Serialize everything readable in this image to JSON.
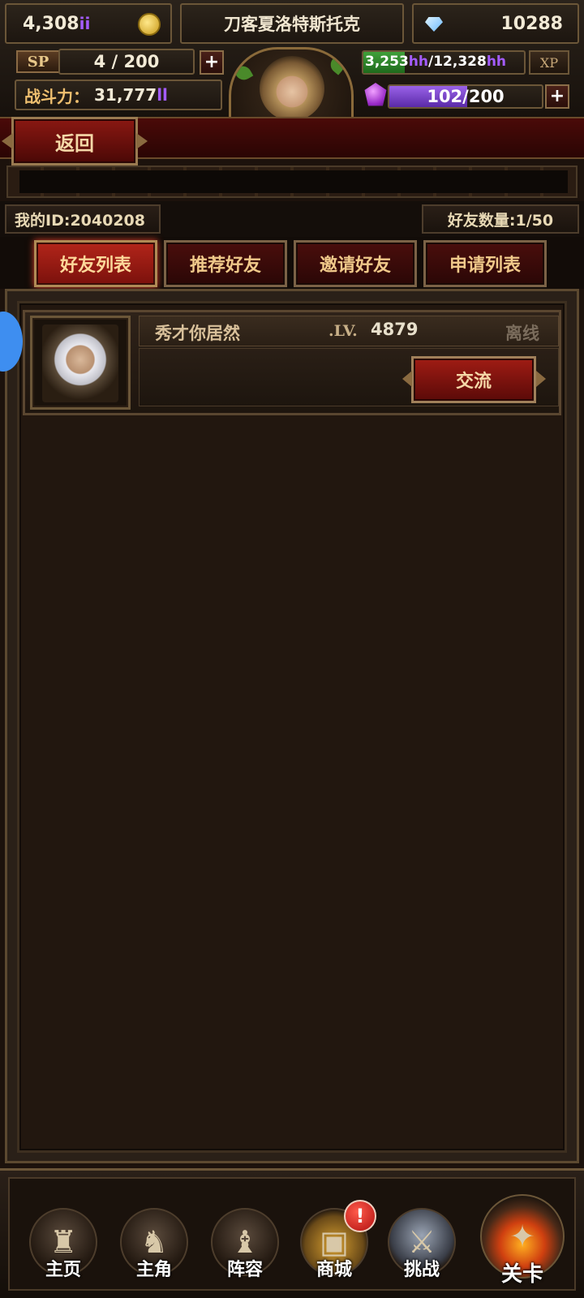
{
  "top": {
    "gold": "4,308",
    "gold_suffix": "ii",
    "player_name": "刀客夏洛特斯托克",
    "diamonds": "10288",
    "sp_label": "SP",
    "sp_value": "4 / 200",
    "combat_label": "战斗力：",
    "combat_value": "31,777",
    "combat_suffix": "ll",
    "xp_current": "3,253",
    "xp_unit": "hh",
    "xp_sep": "/12,328",
    "xp_label": "XP",
    "xp_progress": 0.26,
    "gem_value": "102/200",
    "gem_progress": 0.51,
    "plus": "+"
  },
  "back_label": "返回",
  "info": {
    "my_id": "我的ID:2040208",
    "friend_count": "好友数量:1/50"
  },
  "tabs": [
    {
      "label": "好友列表"
    },
    {
      "label": "推荐好友"
    },
    {
      "label": "邀请好友"
    },
    {
      "label": "申请列表"
    }
  ],
  "friend": {
    "name": "秀才你居然",
    "lv_label": ".LV.",
    "level": "4879",
    "status": "离线",
    "action": "交流"
  },
  "nav": [
    {
      "label": "主页"
    },
    {
      "label": "主角"
    },
    {
      "label": "阵容"
    },
    {
      "label": "商城"
    },
    {
      "label": "挑战"
    },
    {
      "label": "关卡"
    }
  ],
  "notification": "!"
}
